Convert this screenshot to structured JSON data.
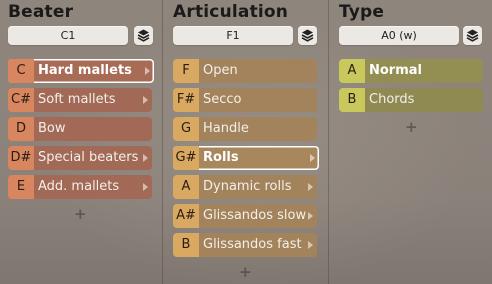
{
  "columns": [
    {
      "title": "Beater",
      "preset": "C1",
      "items": [
        {
          "key": "C",
          "label": "Hard mallets",
          "selected": true
        },
        {
          "key": "C#",
          "label": "Soft mallets"
        },
        {
          "key": "D",
          "label": "Bow"
        },
        {
          "key": "D#",
          "label": "Special beaters"
        },
        {
          "key": "E",
          "label": "Add. mallets"
        }
      ],
      "add_label": "+",
      "colors": {
        "key_bg": "#d7865f",
        "row_bg": "#a26a56",
        "row_sel_bg": "#a86b55"
      }
    },
    {
      "title": "Articulation",
      "preset": "F1",
      "items": [
        {
          "key": "F",
          "label": "Open"
        },
        {
          "key": "F#",
          "label": "Secco"
        },
        {
          "key": "G",
          "label": "Handle"
        },
        {
          "key": "G#",
          "label": "Rolls",
          "selected": true
        },
        {
          "key": "A",
          "label": "Dynamic rolls"
        },
        {
          "key": "A#",
          "label": "Glissandos slow"
        },
        {
          "key": "B",
          "label": "Glissandos fast"
        }
      ],
      "add_label": "+",
      "colors": {
        "key_bg": "#d9a962",
        "row_bg": "#a2835c"
      }
    },
    {
      "title": "Type",
      "preset": "A0 (w)",
      "items": [
        {
          "key": "A",
          "label": "Normal",
          "selected": true
        },
        {
          "key": "B",
          "label": "Chords"
        }
      ],
      "add_label": "+",
      "colors": {
        "key_bg": "#c9c85c",
        "row_bg": "#8f8a52"
      }
    }
  ],
  "icons": {
    "stack": "layers-icon",
    "submenu": "chevron-right-icon",
    "add": "plus-icon"
  }
}
